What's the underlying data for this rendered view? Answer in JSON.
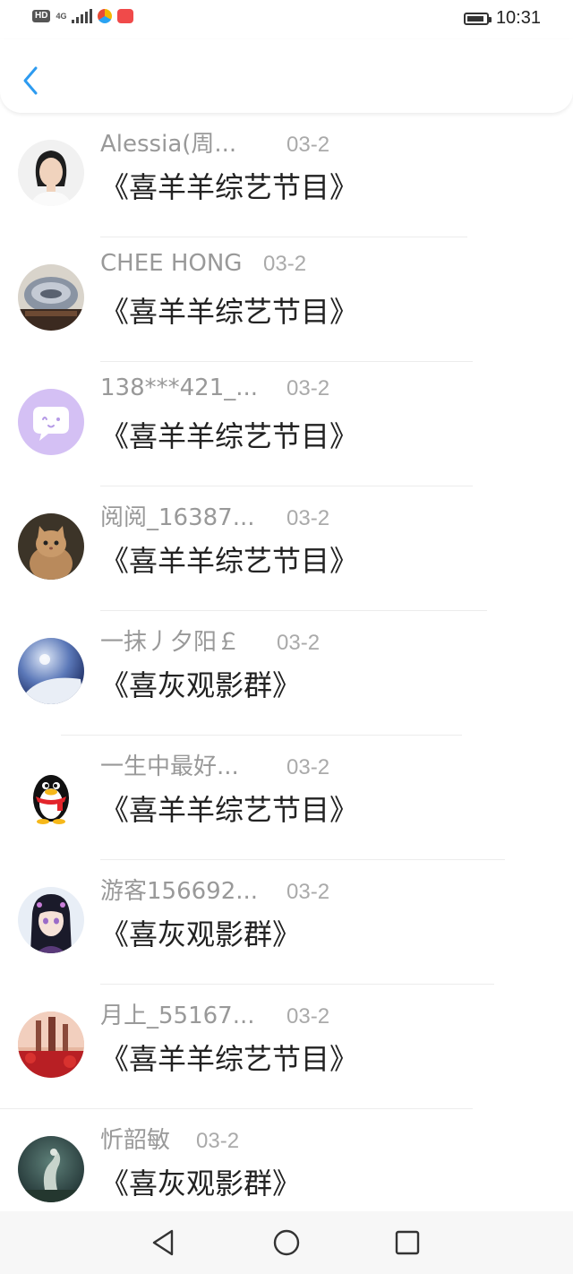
{
  "status_bar": {
    "hd_label": "HD",
    "network_label": "4G",
    "time": "10:31",
    "battery_level": 0.8
  },
  "header": {
    "back_icon": "chevron-left-icon",
    "accent_color": "#2d9bf0"
  },
  "items": [
    {
      "name": "Alessia(周...",
      "date": "03-2",
      "group": "《喜羊羊综艺节目》",
      "avatar": "photo-girl"
    },
    {
      "name": "CHEE HONG",
      "date": "03-2",
      "group": "《喜羊羊综艺节目》",
      "avatar": "photo-stone"
    },
    {
      "name": "138***421_...",
      "date": "03-2",
      "group": "《喜羊羊综艺节目》",
      "avatar": "chat-bubble"
    },
    {
      "name": "阅阅_16387...",
      "date": "03-2",
      "group": "《喜羊羊综艺节目》",
      "avatar": "photo-cat"
    },
    {
      "name": "一抹丿夕阳￡",
      "date": "03-2",
      "group": "《喜灰观影群》",
      "avatar": "photo-sky"
    },
    {
      "name": "一生中最好...",
      "date": "03-2",
      "group": "《喜羊羊综艺节目》",
      "avatar": "penguin"
    },
    {
      "name": "游客156692...",
      "date": "03-2",
      "group": "《喜灰观影群》",
      "avatar": "anime-girl"
    },
    {
      "name": "月上_55167...",
      "date": "03-2",
      "group": "《喜羊羊综艺节目》",
      "avatar": "photo-red-forest"
    },
    {
      "name": "忻韶敏",
      "date": "03-2",
      "group": "《喜灰观影群》",
      "avatar": "photo-dragon"
    }
  ],
  "nav_bar": {
    "back_icon": "triangle-back-icon",
    "home_icon": "circle-home-icon",
    "recents_icon": "square-recents-icon"
  }
}
